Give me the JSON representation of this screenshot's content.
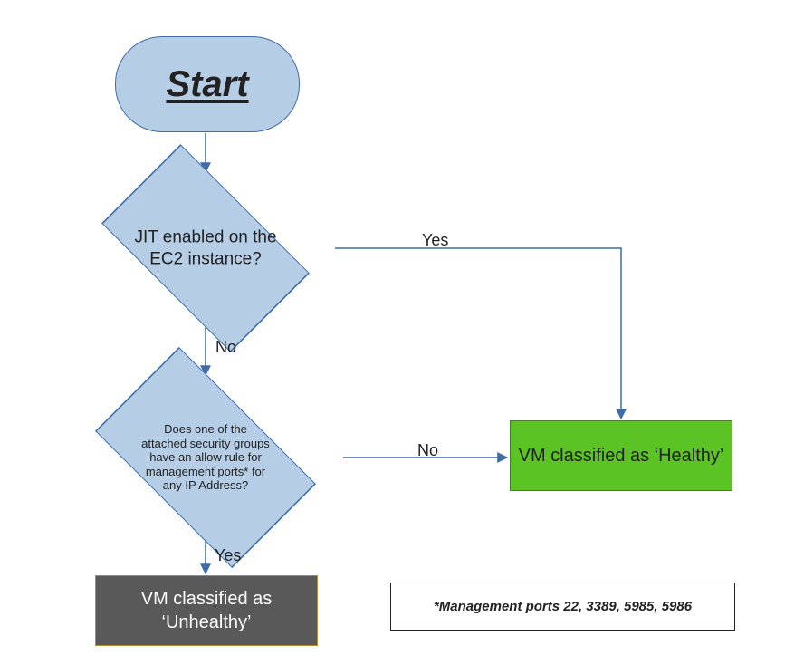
{
  "chart_data": {
    "type": "flowchart",
    "nodes": [
      {
        "id": "start",
        "type": "terminator",
        "label": "Start"
      },
      {
        "id": "d1",
        "type": "decision",
        "label": "JIT enabled on the EC2 instance?"
      },
      {
        "id": "d2",
        "type": "decision",
        "label": "Does one of the attached security groups have an allow rule for management ports* for any IP Address?"
      },
      {
        "id": "healthy",
        "type": "process",
        "label": "VM classified as 'Healthy'",
        "color": "#5cc324"
      },
      {
        "id": "unhealthy",
        "type": "process",
        "label": "VM classified as 'Unhealthy'",
        "color": "#595959"
      }
    ],
    "edges": [
      {
        "from": "start",
        "to": "d1",
        "label": ""
      },
      {
        "from": "d1",
        "to": "healthy",
        "label": "Yes"
      },
      {
        "from": "d1",
        "to": "d2",
        "label": "No"
      },
      {
        "from": "d2",
        "to": "healthy",
        "label": "No"
      },
      {
        "from": "d2",
        "to": "unhealthy",
        "label": "Yes"
      }
    ],
    "footnote": "*Management ports 22, 3389, 5985, 5986"
  },
  "start_label": "Start",
  "d1_text": "JIT enabled on the EC2 instance?",
  "d2_text": "Does one of the attached security groups have an allow rule for management ports* for any IP Address?",
  "healthy_text": "VM classified as ‘Healthy’",
  "unhealthy_text": "VM classified as ‘Unhealthy’",
  "footnote_text": "*Management ports 22, 3389, 5985, 5986",
  "labels": {
    "yes": "Yes",
    "no": "No"
  },
  "colors": {
    "shape_fill": "#b6cde6",
    "shape_border": "#3f6ba6",
    "healthy": "#5cc324",
    "unhealthy": "#595959",
    "arrow": "#3f6ba6"
  }
}
